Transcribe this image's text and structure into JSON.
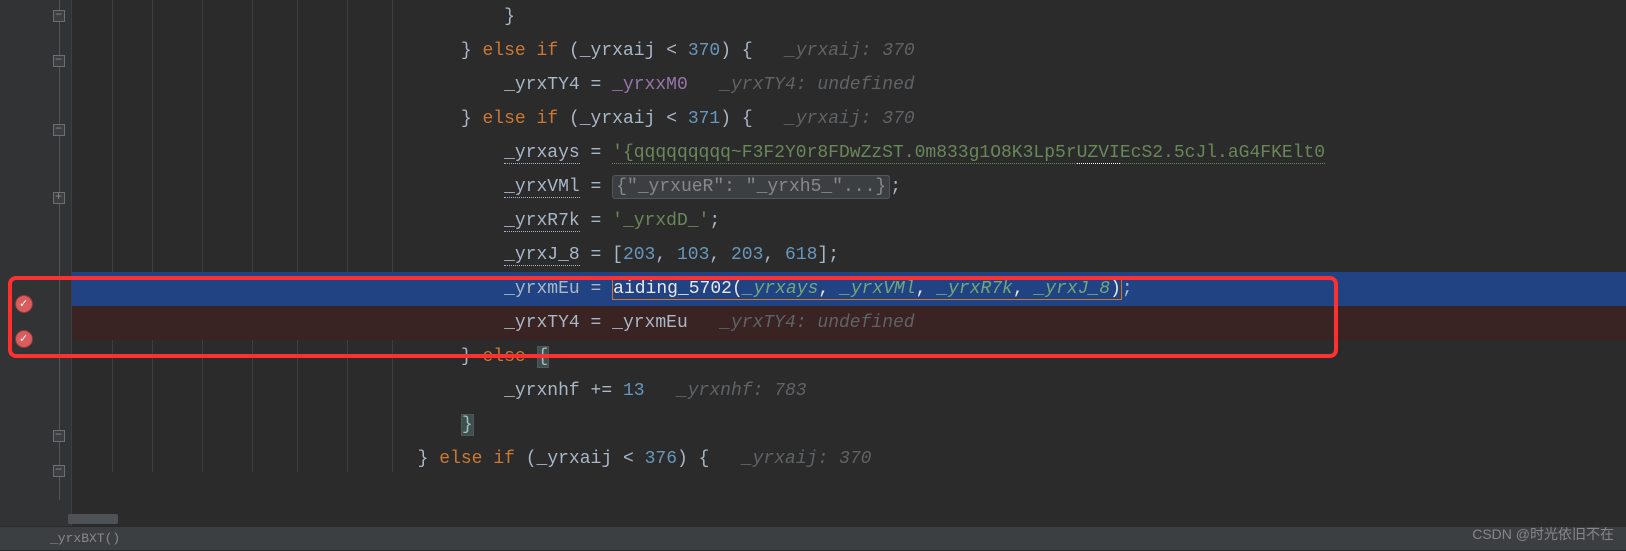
{
  "lines": {
    "l0": {
      "brace": "}"
    },
    "l1": {
      "brace1": "}",
      "kw1": "else",
      "kw2": "if",
      "cond_var": "_yrxaij",
      "op": "<",
      "cond_val": "370",
      "brace2": "{",
      "hint": "_yrxaij: 370"
    },
    "l2": {
      "var": "_yrxTY4",
      "op": "=",
      "rhs": "_yrxxM0",
      "hint": "_yrxTY4: undefined"
    },
    "l3": {
      "brace1": "}",
      "kw1": "else",
      "kw2": "if",
      "cond_var": "_yrxaij",
      "op": "<",
      "cond_val": "371",
      "brace2": "{",
      "hint": "_yrxaij: 370"
    },
    "l4": {
      "var": "_yrxays",
      "op": "=",
      "str_pre": "'{qqqqqqqqq~F3F2Y0r8FDwZzST.0m833g1O8K3Lp5r",
      "uzvi": "UZVI",
      "str_post": "EcS2.5cJl.aG4FKElt0"
    },
    "l5": {
      "var": "_yrxVMl",
      "op": "=",
      "fold": "{\"_yrxueR\": \"_yrxh5_\"...}",
      "semi": ";"
    },
    "l6": {
      "var": "_yrxR7k",
      "op": "=",
      "str": "'_yrxdD_'",
      "semi": ";"
    },
    "l7": {
      "var": "_yrxJ_8",
      "op": "=",
      "arr_open": "[",
      "v1": "203",
      "c1": ", ",
      "v2": "103",
      "c2": ", ",
      "v3": "203",
      "c3": ", ",
      "v4": "618",
      "arr_close": "]",
      "semi": ";"
    },
    "l8": {
      "var": "_yrxmEu",
      "op": "=",
      "func": "aiding_5702",
      "p1": "_yrxays",
      "p2": "_yrxVMl",
      "p3": "_yrxR7k",
      "p4": "_yrxJ_8",
      "semi": ";"
    },
    "l9": {
      "var": "_yrxTY4",
      "op": "=",
      "rhs": "_yrxmEu",
      "hint": "_yrxTY4: undefined"
    },
    "l10": {
      "brace1": "}",
      "kw1": "else",
      "brace2": "{"
    },
    "l11": {
      "var": "_yrxnhf",
      "op": "+=",
      "val": "13",
      "hint": "_yrxnhf: 783"
    },
    "l12": {
      "brace": "}"
    },
    "l13": {
      "brace1": "}",
      "kw1": "else",
      "kw2": "if",
      "cond_var": "_yrxaij",
      "op": "<",
      "cond_val": "376",
      "brace2": "{",
      "hint": "_yrxaij: 370"
    }
  },
  "status": "_yrxBXT()",
  "watermark": "CSDN @时光依旧不在"
}
